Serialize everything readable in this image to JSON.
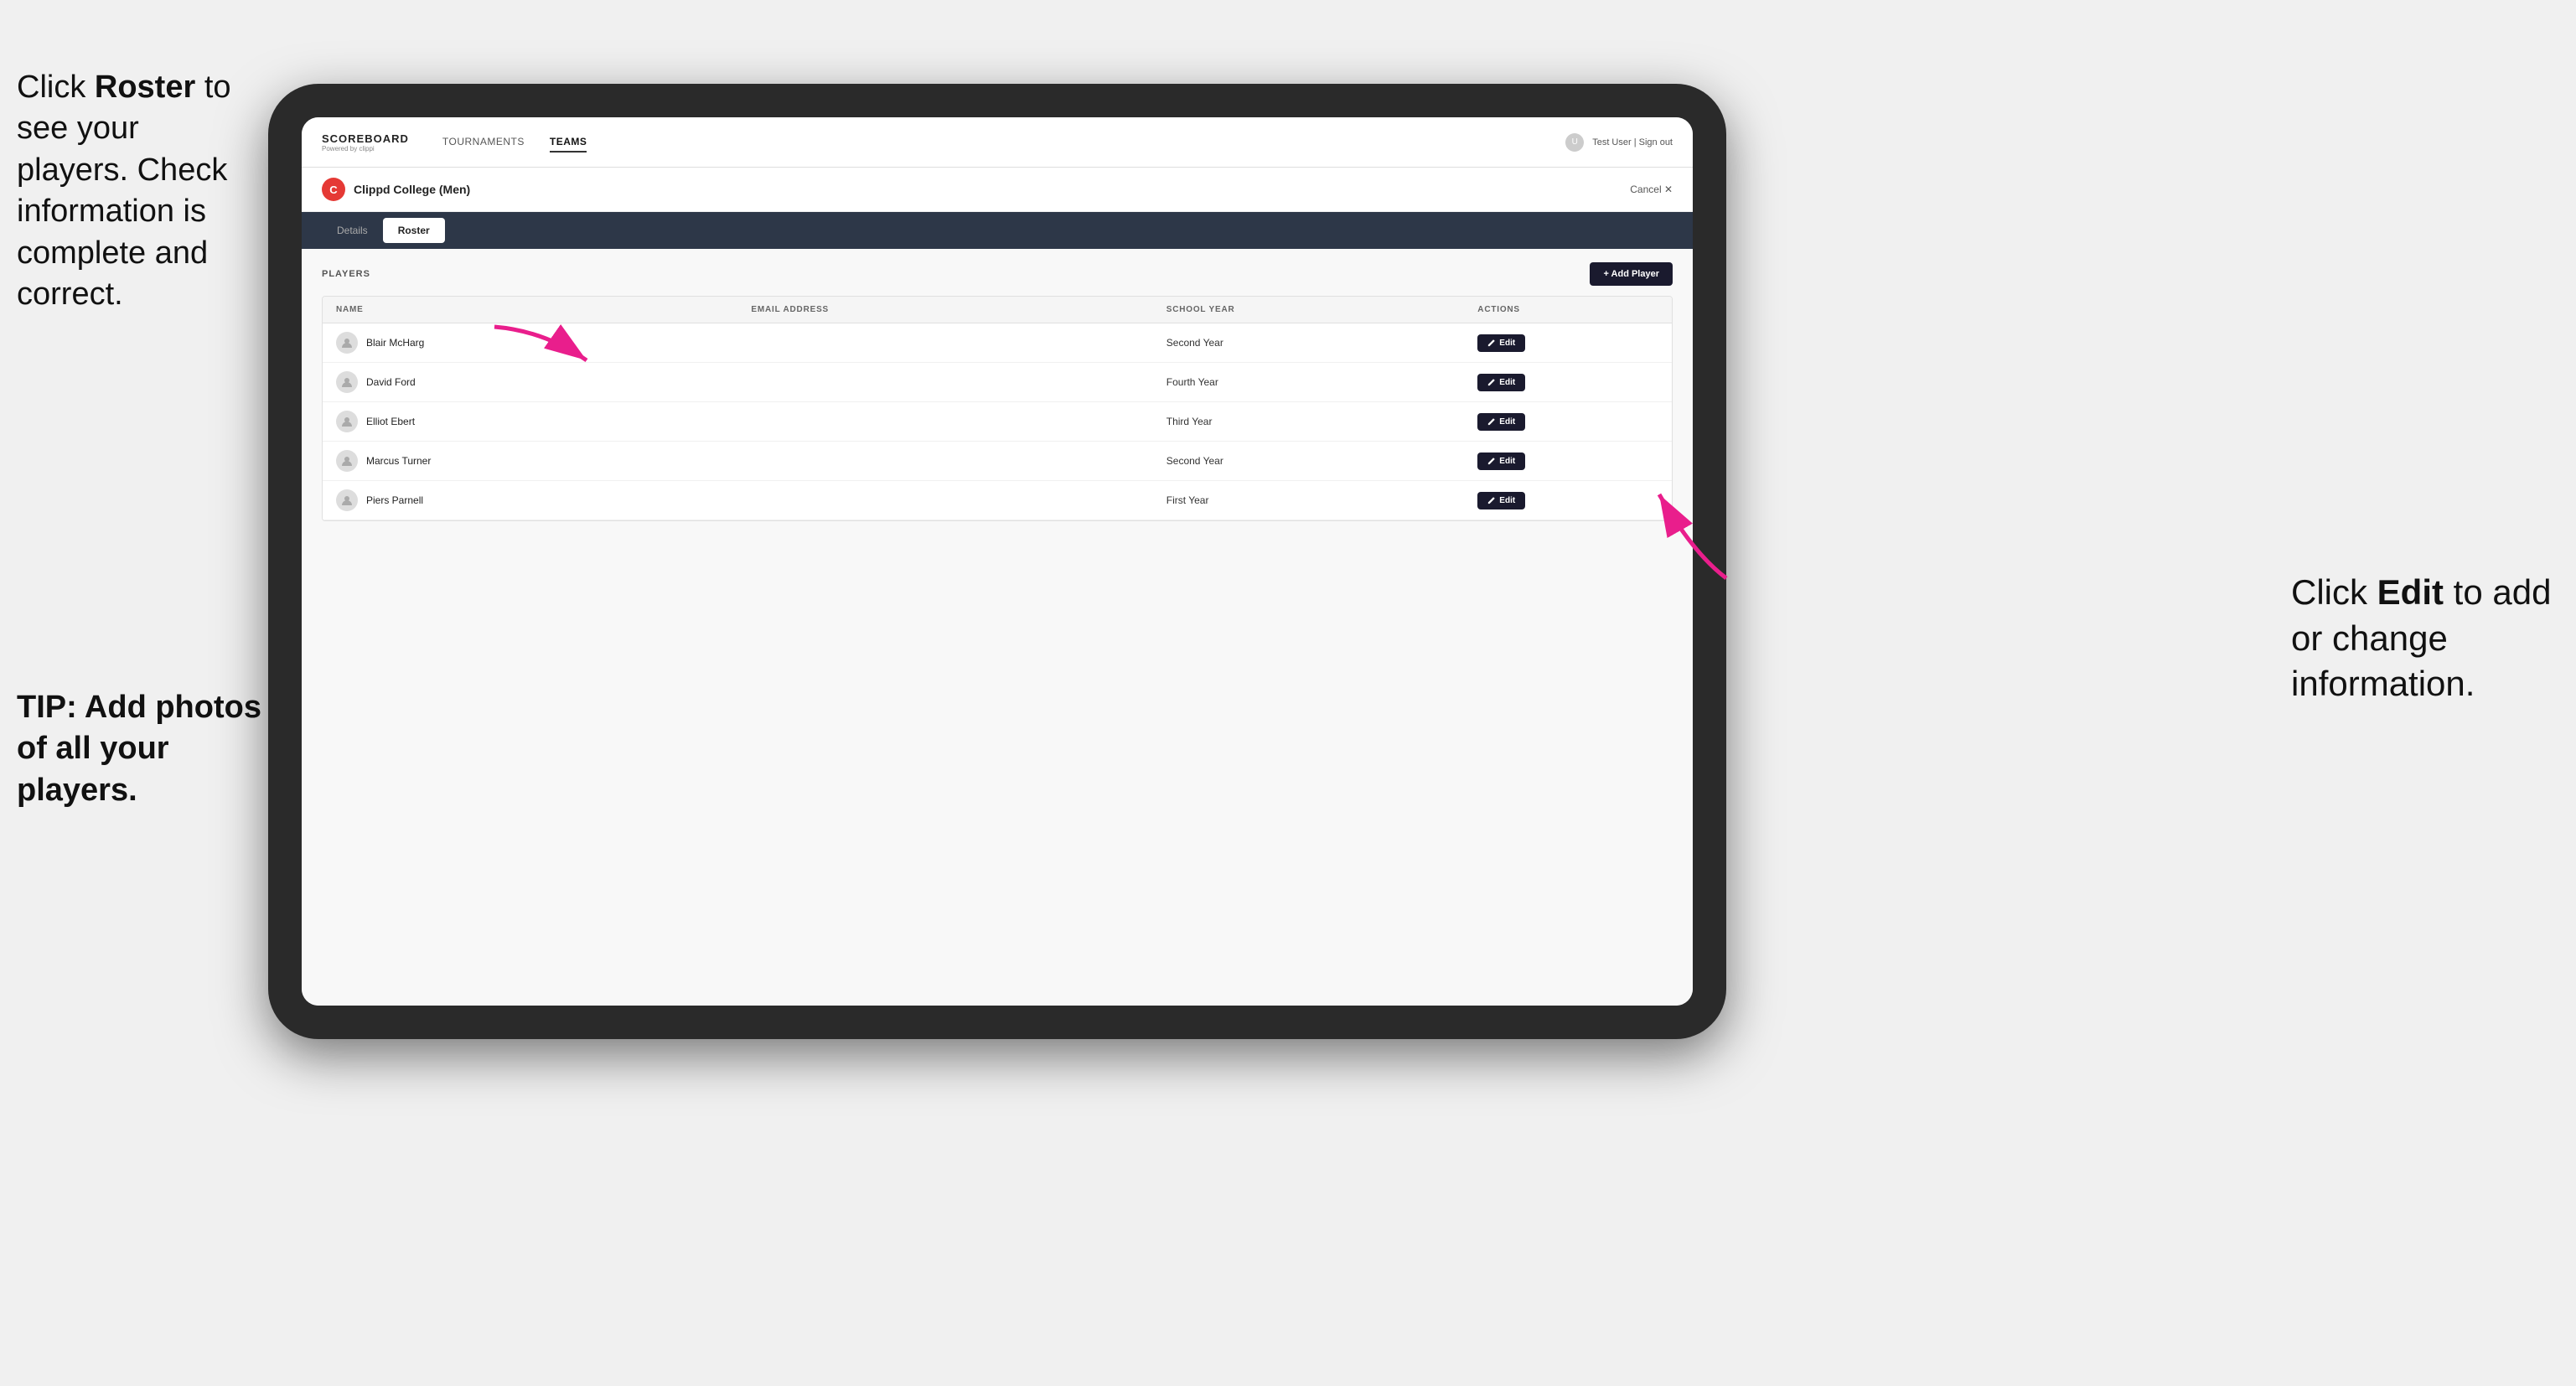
{
  "instructions": {
    "left_line1": "Click ",
    "left_bold": "Roster",
    "left_line2": " to see your players. Check information is complete and correct.",
    "tip": "TIP: Add photos of all your players."
  },
  "right_instruction": {
    "line1": "Click ",
    "bold": "Edit",
    "line2": " to add or change information."
  },
  "navbar": {
    "logo": "SCOREBOARD",
    "logo_sub": "Powered by clippi",
    "nav_items": [
      {
        "label": "TOURNAMENTS",
        "active": false
      },
      {
        "label": "TEAMS",
        "active": true
      }
    ],
    "user_text": "Test User | Sign out"
  },
  "team": {
    "logo_letter": "C",
    "name": "Clippd College (Men)",
    "cancel_label": "Cancel ✕"
  },
  "tabs": [
    {
      "label": "Details",
      "active": false
    },
    {
      "label": "Roster",
      "active": true
    }
  ],
  "players_section": {
    "label": "PLAYERS",
    "add_button": "+ Add Player"
  },
  "table": {
    "headers": [
      "NAME",
      "EMAIL ADDRESS",
      "SCHOOL YEAR",
      "ACTIONS"
    ],
    "rows": [
      {
        "name": "Blair McHarg",
        "email": "",
        "school_year": "Second Year"
      },
      {
        "name": "David Ford",
        "email": "",
        "school_year": "Fourth Year"
      },
      {
        "name": "Elliot Ebert",
        "email": "",
        "school_year": "Third Year"
      },
      {
        "name": "Marcus Turner",
        "email": "",
        "school_year": "Second Year"
      },
      {
        "name": "Piers Parnell",
        "email": "",
        "school_year": "First Year"
      }
    ],
    "edit_label": "Edit"
  }
}
